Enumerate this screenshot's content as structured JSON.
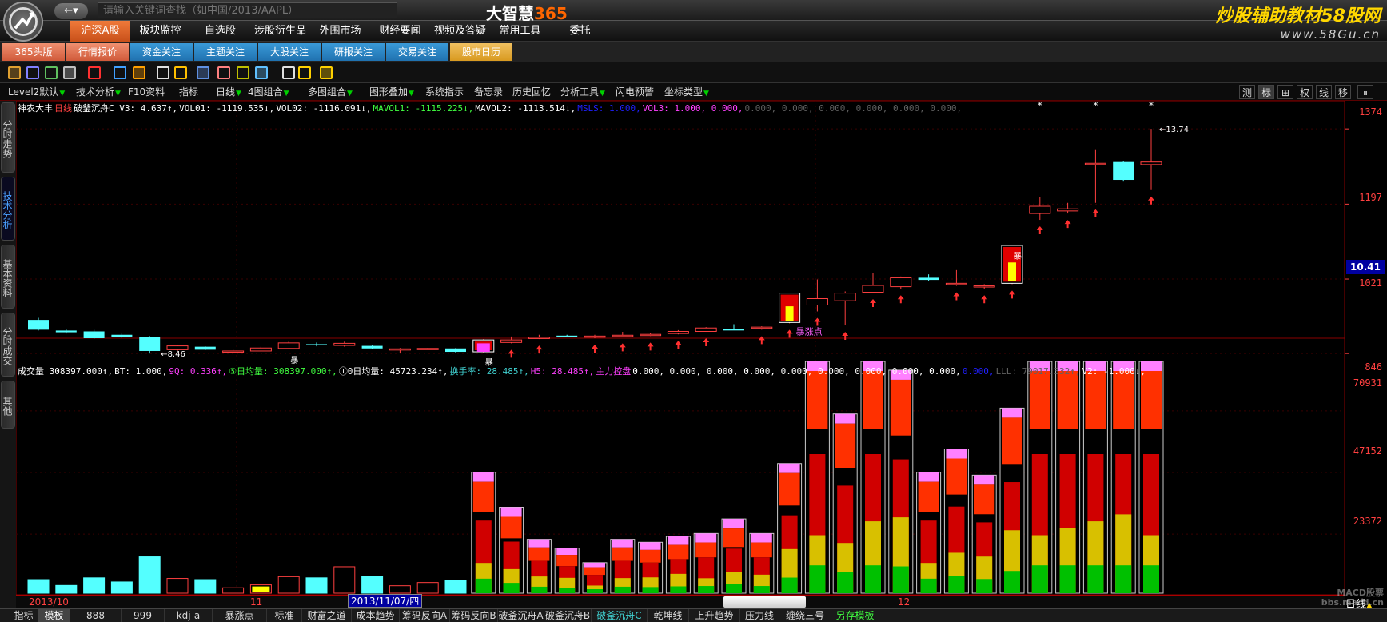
{
  "top": {
    "back_label": "←▾",
    "search_placeholder": "请输入关键词查找（如中国/2013/AAPL）",
    "brand_main": "大智慧",
    "brand_accent": "365",
    "watermark_line1": "炒股辅助教材58股网",
    "watermark_line2": "www.58Gu.cn"
  },
  "main_nav": [
    {
      "label": "沪深A股",
      "active": true
    },
    {
      "label": "板块监控"
    },
    {
      "label": "自选股"
    },
    {
      "label": "涉股衍生品"
    },
    {
      "label": "外围市场"
    },
    {
      "label": "财经要闻"
    },
    {
      "label": "视频及答疑"
    },
    {
      "label": "常用工具"
    },
    {
      "label": "委托"
    }
  ],
  "sub_nav": [
    {
      "label": "365头版",
      "color": "orange"
    },
    {
      "label": "行情报价",
      "color": "orange"
    },
    {
      "label": "资金关注",
      "color": "blue"
    },
    {
      "label": "主题关注",
      "color": "blue"
    },
    {
      "label": "大股关注",
      "color": "blue"
    },
    {
      "label": "研报关注",
      "color": "blue"
    },
    {
      "label": "交易关注",
      "color": "blue"
    },
    {
      "label": "股市日历",
      "color": "amber"
    }
  ],
  "toolbar_icons": [
    "folder-icon",
    "window-icon",
    "chart-icon",
    "grid-icon",
    "stop-icon",
    "crosshair-icon",
    "candle-icon",
    "line-icon",
    "bell-icon",
    "picture-icon",
    "draw-icon",
    "angle-icon",
    "text-icon",
    "note-icon",
    "info-icon",
    "diamond-icon"
  ],
  "func_toolbar": [
    {
      "label": "Level2默认",
      "tri": true
    },
    {
      "label": "技术分析",
      "tri": true
    },
    {
      "label": "F10资料",
      "tri": false
    },
    {
      "label": "指标",
      "tri": false
    },
    {
      "label": "日线",
      "tri": true
    },
    {
      "label": "4图组合",
      "tri": true
    },
    {
      "label": "多图组合",
      "tri": true
    },
    {
      "label": "图形叠加",
      "tri": true
    },
    {
      "label": "系统指示",
      "tri": false
    },
    {
      "label": "备忘录",
      "tri": false
    },
    {
      "label": "历史回忆",
      "tri": false
    },
    {
      "label": "分析工具",
      "tri": true
    },
    {
      "label": "闪电预警",
      "tri": false
    },
    {
      "label": "坐标类型",
      "tri": true
    }
  ],
  "right_buttons": [
    "测",
    "标",
    "⊞",
    "权",
    "线",
    "移",
    "⏸"
  ],
  "left_tabs": [
    {
      "label": "分时走势"
    },
    {
      "label": "技术分析",
      "active": true
    },
    {
      "label": "基本资料"
    },
    {
      "label": "分时成交"
    },
    {
      "label": "其他"
    }
  ],
  "legend_price": [
    {
      "text": "神农大丰",
      "color": "#ffffff"
    },
    {
      "text": "日线",
      "color": "#ff4040"
    },
    {
      "text": "破釜沉舟C V3: 4.637↑,",
      "color": "#ffffff"
    },
    {
      "text": "VOL01: -1119.535↓,",
      "color": "#ffffff"
    },
    {
      "text": "VOL02: -1116.091↓,",
      "color": "#ffffff"
    },
    {
      "text": "MAVOL1: -1115.225↓,",
      "color": "#40ff40"
    },
    {
      "text": "MAVOL2: -1113.514↓,",
      "color": "#ffffff"
    },
    {
      "text": "MSLS: 1.000,",
      "color": "#2020ff"
    },
    {
      "text": "VOL3: 1.000, 0.000,",
      "color": "#ff40ff"
    },
    {
      "text": "0.000, 0.000, 0.000, 0.000, 0.000, 0.000,",
      "color": "#606060"
    }
  ],
  "legend_volume": [
    {
      "text": "成交量 308397.000↑,",
      "color": "#ffffff"
    },
    {
      "text": "BT: 1.000,",
      "color": "#ffffff"
    },
    {
      "text": "9Q: 0.336↑,",
      "color": "#ff40ff"
    },
    {
      "text": "⑤日均量: 308397.000↑,",
      "color": "#40ff40"
    },
    {
      "text": "①0日均量: 45723.234↑,",
      "color": "#ffffff"
    },
    {
      "text": "换手率: 28.485↑,",
      "color": "#40d0d0"
    },
    {
      "text": "H5: 28.485↑,",
      "color": "#ff40ff"
    },
    {
      "text": "主力控盘",
      "color": "#ff40ff"
    },
    {
      "text": "0.000, 0.000, 0.000, 0.000, 0.000, 0.000, 0.000, 0.000, 0.000,",
      "color": "#ffffff"
    },
    {
      "text": "0.000,",
      "color": "#2020ff"
    },
    {
      "text": "LLL: 79017.332↑,",
      "color": "#606060"
    },
    {
      "text": "V2: -1.000↓,",
      "color": "#ffffff"
    }
  ],
  "price_axis": [
    "1374",
    "1197",
    "1021",
    "846"
  ],
  "volume_axis": [
    "70931",
    "47152",
    "23372"
  ],
  "current_price": "10.41",
  "annotations": {
    "low_label": "8.46",
    "high_label": "13.74",
    "label_bao": "暴",
    "label_baozhang": "暴涨点"
  },
  "date_axis": [
    {
      "label": "2013/10"
    },
    {
      "label": "11"
    },
    {
      "label": "12"
    }
  ],
  "date_cursor": "2013/11/07/四",
  "period_label": "日线",
  "bottom_tabs": [
    {
      "label": "指标"
    },
    {
      "label": "模板",
      "active": true
    },
    {
      "label": "888"
    },
    {
      "label": "999"
    },
    {
      "label": "kdj-a"
    },
    {
      "label": "暴涨点"
    },
    {
      "label": "标准"
    },
    {
      "label": "财富之道"
    },
    {
      "label": "成本趋势"
    },
    {
      "label": "筹码反向A"
    },
    {
      "label": "筹码反向B"
    },
    {
      "label": "破釜沉舟A"
    },
    {
      "label": "破釜沉舟B"
    },
    {
      "label": "破釜沉舟C",
      "color": "teal"
    },
    {
      "label": "乾坤线"
    },
    {
      "label": "上升趋势"
    },
    {
      "label": "压力线"
    },
    {
      "label": "缠绕三号"
    },
    {
      "label": "另存模板",
      "color": "green"
    }
  ],
  "watermark_bottom": [
    "MACD股票",
    "bbs.macd.cn"
  ],
  "chart_data": {
    "type": "candlestick",
    "title": "神农大丰 日线",
    "price_range": [
      8.2,
      14.1
    ],
    "volume_range": [
      0,
      80000
    ],
    "candles": [
      {
        "o": 9.25,
        "h": 9.3,
        "l": 9.0,
        "c": 9.02,
        "bull": false
      },
      {
        "o": 9.0,
        "h": 9.03,
        "l": 8.93,
        "c": 8.96,
        "bull": false
      },
      {
        "o": 8.98,
        "h": 9.02,
        "l": 8.8,
        "c": 8.82,
        "bull": false
      },
      {
        "o": 8.9,
        "h": 8.93,
        "l": 8.82,
        "c": 8.85,
        "bull": false
      },
      {
        "o": 8.85,
        "h": 8.87,
        "l": 8.46,
        "c": 8.52,
        "bull": false
      },
      {
        "o": 8.55,
        "h": 8.66,
        "l": 8.52,
        "c": 8.64,
        "bull": true
      },
      {
        "o": 8.62,
        "h": 8.63,
        "l": 8.54,
        "c": 8.55,
        "bull": false
      },
      {
        "o": 8.52,
        "h": 8.55,
        "l": 8.47,
        "c": 8.52,
        "bull": true
      },
      {
        "o": 8.52,
        "h": 8.62,
        "l": 8.51,
        "c": 8.59,
        "bull": true
      },
      {
        "o": 8.58,
        "h": 8.74,
        "l": 8.57,
        "c": 8.71,
        "bull": true
      },
      {
        "o": 8.66,
        "h": 8.72,
        "l": 8.63,
        "c": 8.68,
        "bull": false
      },
      {
        "o": 8.65,
        "h": 8.74,
        "l": 8.62,
        "c": 8.7,
        "bull": true
      },
      {
        "o": 8.64,
        "h": 8.65,
        "l": 8.56,
        "c": 8.58,
        "bull": false
      },
      {
        "o": 8.55,
        "h": 8.59,
        "l": 8.48,
        "c": 8.57,
        "bull": true
      },
      {
        "o": 8.57,
        "h": 8.59,
        "l": 8.55,
        "c": 8.58,
        "bull": true
      },
      {
        "o": 8.58,
        "h": 8.59,
        "l": 8.48,
        "c": 8.5,
        "bull": false
      },
      {
        "o": 8.5,
        "h": 8.8,
        "l": 8.48,
        "c": 8.78,
        "bull": true
      },
      {
        "o": 8.72,
        "h": 8.86,
        "l": 8.7,
        "c": 8.78,
        "bull": true
      },
      {
        "o": 8.83,
        "h": 8.9,
        "l": 8.8,
        "c": 8.84,
        "bull": true
      },
      {
        "o": 8.88,
        "h": 8.9,
        "l": 8.86,
        "c": 8.87,
        "bull": false
      },
      {
        "o": 8.86,
        "h": 8.9,
        "l": 8.82,
        "c": 8.87,
        "bull": true
      },
      {
        "o": 8.87,
        "h": 8.97,
        "l": 8.85,
        "c": 8.89,
        "bull": true
      },
      {
        "o": 8.89,
        "h": 8.95,
        "l": 8.87,
        "c": 8.91,
        "bull": true
      },
      {
        "o": 8.93,
        "h": 9.01,
        "l": 8.91,
        "c": 8.98,
        "bull": true
      },
      {
        "o": 8.98,
        "h": 9.08,
        "l": 8.97,
        "c": 9.06,
        "bull": true
      },
      {
        "o": 9.02,
        "h": 9.15,
        "l": 9.01,
        "c": 9.03,
        "bull": false
      },
      {
        "o": 9.06,
        "h": 9.1,
        "l": 9.02,
        "c": 9.08,
        "bull": true
      },
      {
        "o": 9.19,
        "h": 9.88,
        "l": 9.17,
        "c": 9.88,
        "bull": true
      },
      {
        "o": 9.6,
        "h": 10.2,
        "l": 9.45,
        "c": 9.75,
        "bull": true
      },
      {
        "o": 9.7,
        "h": 9.92,
        "l": 9.12,
        "c": 9.88,
        "bull": true
      },
      {
        "o": 9.9,
        "h": 10.35,
        "l": 9.89,
        "c": 10.06,
        "bull": true
      },
      {
        "o": 10.03,
        "h": 10.27,
        "l": 9.98,
        "c": 10.24,
        "bull": true
      },
      {
        "o": 10.24,
        "h": 10.32,
        "l": 10.17,
        "c": 10.19,
        "bull": false
      },
      {
        "o": 10.09,
        "h": 10.42,
        "l": 10.05,
        "c": 10.11,
        "bull": true
      },
      {
        "o": 10.04,
        "h": 10.09,
        "l": 9.98,
        "c": 10.05,
        "bull": true
      },
      {
        "o": 10.11,
        "h": 11.0,
        "l": 10.09,
        "c": 11.0,
        "bull": true
      },
      {
        "o": 11.92,
        "h": 12.14,
        "l": 11.6,
        "c": 11.75,
        "bull": true
      },
      {
        "o": 11.86,
        "h": 12.0,
        "l": 11.75,
        "c": 11.81,
        "bull": true
      },
      {
        "o": 12.92,
        "h": 13.26,
        "l": 12.0,
        "c": 12.93,
        "bull": true
      },
      {
        "o": 12.96,
        "h": 12.99,
        "l": 12.5,
        "c": 12.54,
        "bull": false
      },
      {
        "o": 12.9,
        "h": 13.74,
        "l": 12.3,
        "c": 12.96,
        "bull": true
      }
    ],
    "volume": [
      5200,
      3200,
      5800,
      4400,
      13000,
      5600,
      5200,
      2400,
      3400,
      6200,
      5800,
      9600,
      6400,
      3100,
      4200,
      4900,
      42000,
      30000,
      19000,
      16000,
      11000,
      19000,
      18000,
      20000,
      21000,
      26000,
      21000,
      45000,
      90000,
      62000,
      81000,
      77000,
      42000,
      50000,
      41000,
      64000,
      115000,
      81000,
      89000,
      99000,
      123000
    ],
    "volume_ticks": [
      70931,
      47152,
      23372
    ],
    "price_ticks": [
      13.74,
      11.97,
      10.21,
      8.46
    ]
  }
}
